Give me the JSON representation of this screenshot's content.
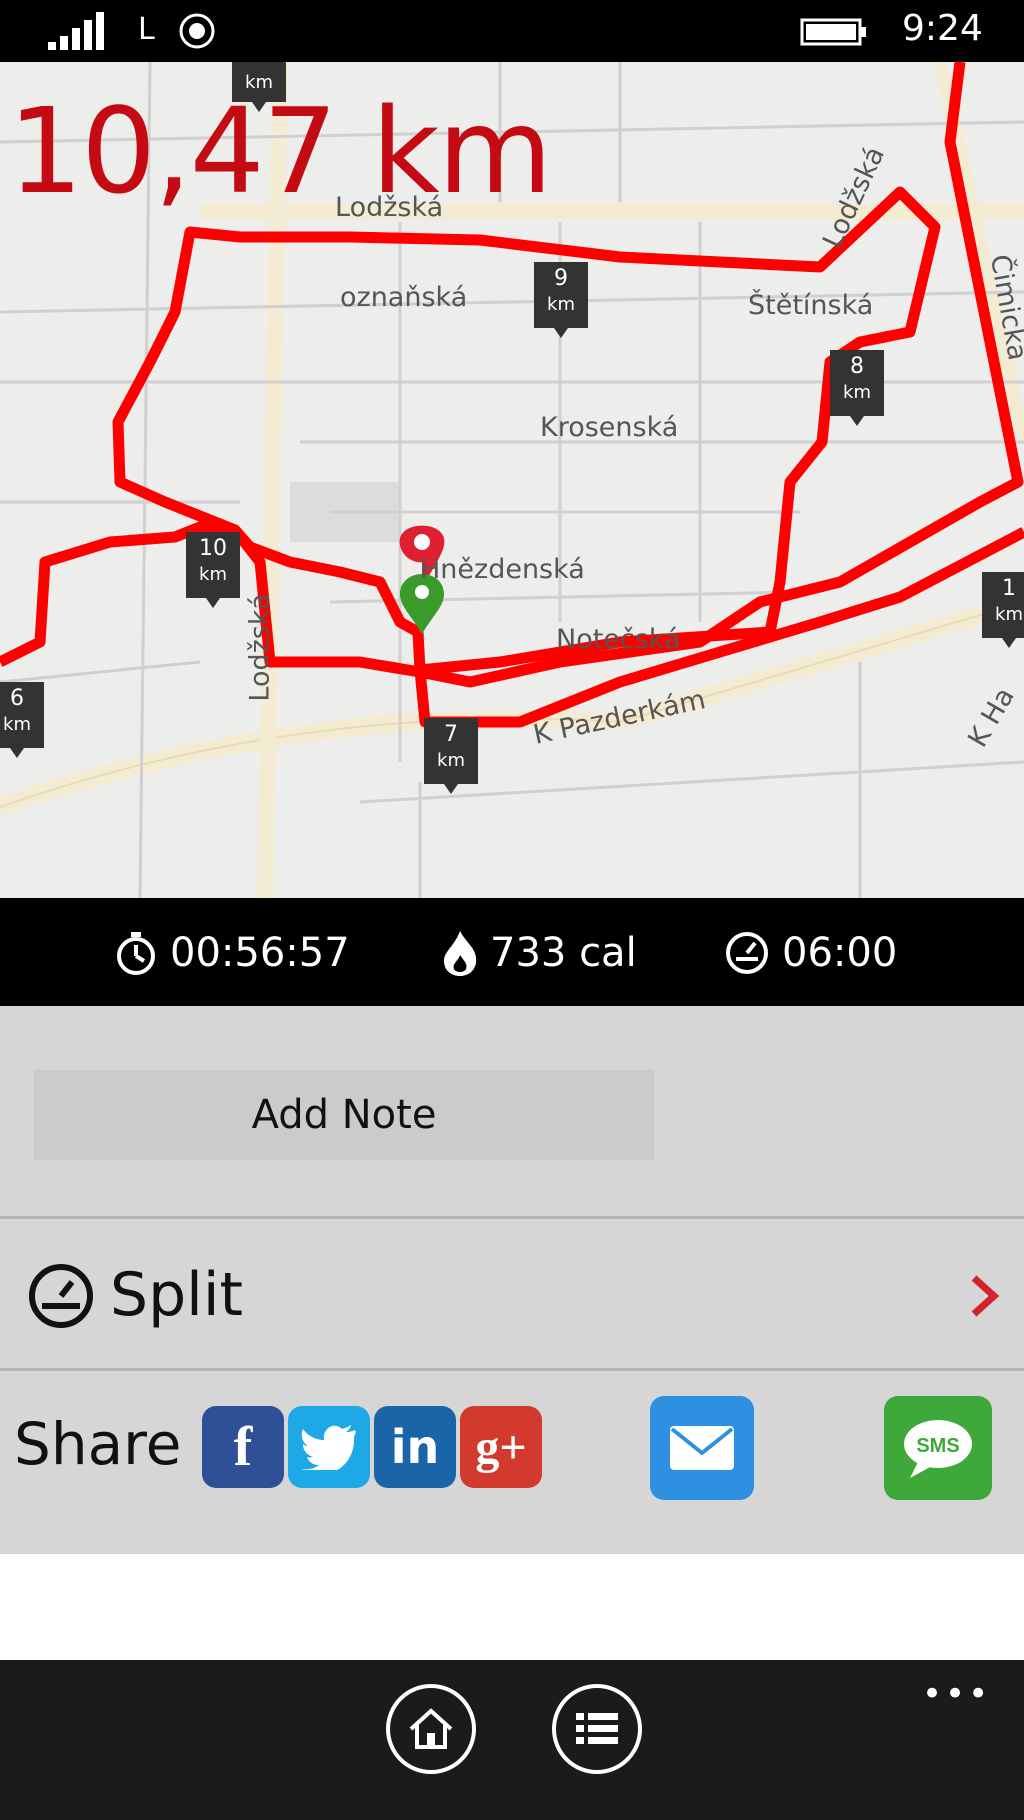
{
  "status_bar": {
    "network_type": "L",
    "time": "9:24"
  },
  "map": {
    "distance": "10,47 km",
    "streets": [
      "Lodžská",
      "Lodžská",
      "oznaňská",
      "Štětínská",
      "Krosenská",
      "Hnězdenská",
      "Notečská",
      "K Pazderkám",
      "Lodžská",
      "Čimická",
      "K Ha"
    ],
    "km_markers": [
      {
        "num": "",
        "unit": "km"
      },
      {
        "num": "9",
        "unit": "km"
      },
      {
        "num": "8",
        "unit": "km"
      },
      {
        "num": "10",
        "unit": "km"
      },
      {
        "num": "1",
        "unit": "km"
      },
      {
        "num": "6",
        "unit": "km"
      },
      {
        "num": "7",
        "unit": "km"
      }
    ],
    "route_color": "#ff0000"
  },
  "stats": {
    "duration": "00:56:57",
    "calories": "733 cal",
    "pace": "06:00"
  },
  "actions": {
    "add_note": "Add Note",
    "split": "Split",
    "share": "Share",
    "share_targets": [
      "facebook",
      "twitter",
      "linkedin",
      "google-plus",
      "email",
      "sms"
    ],
    "sms_label": "SMS"
  },
  "app_bar": {
    "buttons": [
      "home-icon",
      "list-icon"
    ],
    "more": "•••"
  }
}
